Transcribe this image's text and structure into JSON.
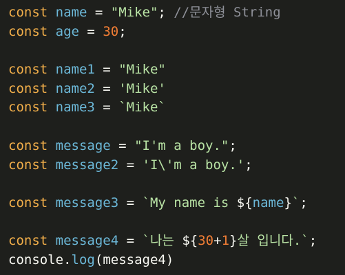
{
  "editor": {
    "lines": [
      [
        {
          "t": "const",
          "c": "kw"
        },
        {
          "t": " ",
          "c": "pl"
        },
        {
          "t": "name",
          "c": "var"
        },
        {
          "t": " = ",
          "c": "op"
        },
        {
          "t": "\"Mike\"",
          "c": "str"
        },
        {
          "t": "; ",
          "c": "pl"
        },
        {
          "t": "//문자형 String",
          "c": "cmt"
        }
      ],
      [
        {
          "t": "const",
          "c": "kw"
        },
        {
          "t": " ",
          "c": "pl"
        },
        {
          "t": "age",
          "c": "var"
        },
        {
          "t": " = ",
          "c": "op"
        },
        {
          "t": "30",
          "c": "num"
        },
        {
          "t": ";",
          "c": "pl"
        }
      ],
      [],
      [
        {
          "t": "const",
          "c": "kw"
        },
        {
          "t": " ",
          "c": "pl"
        },
        {
          "t": "name1",
          "c": "var"
        },
        {
          "t": " = ",
          "c": "op"
        },
        {
          "t": "\"Mike\"",
          "c": "str"
        }
      ],
      [
        {
          "t": "const",
          "c": "kw"
        },
        {
          "t": " ",
          "c": "pl"
        },
        {
          "t": "name2",
          "c": "var"
        },
        {
          "t": " = ",
          "c": "op"
        },
        {
          "t": "'Mike'",
          "c": "str"
        }
      ],
      [
        {
          "t": "const",
          "c": "kw"
        },
        {
          "t": " ",
          "c": "pl"
        },
        {
          "t": "name3",
          "c": "var"
        },
        {
          "t": " = ",
          "c": "op"
        },
        {
          "t": "`Mike`",
          "c": "str"
        }
      ],
      [],
      [
        {
          "t": "const",
          "c": "kw"
        },
        {
          "t": " ",
          "c": "pl"
        },
        {
          "t": "message",
          "c": "var"
        },
        {
          "t": " = ",
          "c": "op"
        },
        {
          "t": "\"I'm a boy.\"",
          "c": "str"
        },
        {
          "t": ";",
          "c": "pl"
        }
      ],
      [
        {
          "t": "const",
          "c": "kw"
        },
        {
          "t": " ",
          "c": "pl"
        },
        {
          "t": "message2",
          "c": "var"
        },
        {
          "t": " = ",
          "c": "op"
        },
        {
          "t": "'I\\'m a boy.'",
          "c": "str"
        },
        {
          "t": ";",
          "c": "pl"
        }
      ],
      [],
      [
        {
          "t": "const",
          "c": "kw"
        },
        {
          "t": " ",
          "c": "pl"
        },
        {
          "t": "message3",
          "c": "var"
        },
        {
          "t": " = ",
          "c": "op"
        },
        {
          "t": "`My name is ",
          "c": "str"
        },
        {
          "t": "${",
          "c": "pl"
        },
        {
          "t": "name",
          "c": "var"
        },
        {
          "t": "}",
          "c": "pl"
        },
        {
          "t": "`",
          "c": "str"
        },
        {
          "t": ";",
          "c": "pl"
        }
      ],
      [],
      [
        {
          "t": "const",
          "c": "kw"
        },
        {
          "t": " ",
          "c": "pl"
        },
        {
          "t": "message4",
          "c": "var"
        },
        {
          "t": " = ",
          "c": "op"
        },
        {
          "t": "`나는 ",
          "c": "str"
        },
        {
          "t": "${",
          "c": "pl"
        },
        {
          "t": "30",
          "c": "num"
        },
        {
          "t": "+",
          "c": "pl"
        },
        {
          "t": "1",
          "c": "num"
        },
        {
          "t": "}",
          "c": "pl"
        },
        {
          "t": "살 입니다.`",
          "c": "str"
        },
        {
          "t": ";",
          "c": "pl"
        }
      ],
      [
        {
          "t": "console",
          "c": "pl"
        },
        {
          "t": ".",
          "c": "pl"
        },
        {
          "t": "log",
          "c": "var"
        },
        {
          "t": "(",
          "c": "pl"
        },
        {
          "t": "message4",
          "c": "pl"
        },
        {
          "t": ")",
          "c": "pl"
        }
      ]
    ]
  }
}
